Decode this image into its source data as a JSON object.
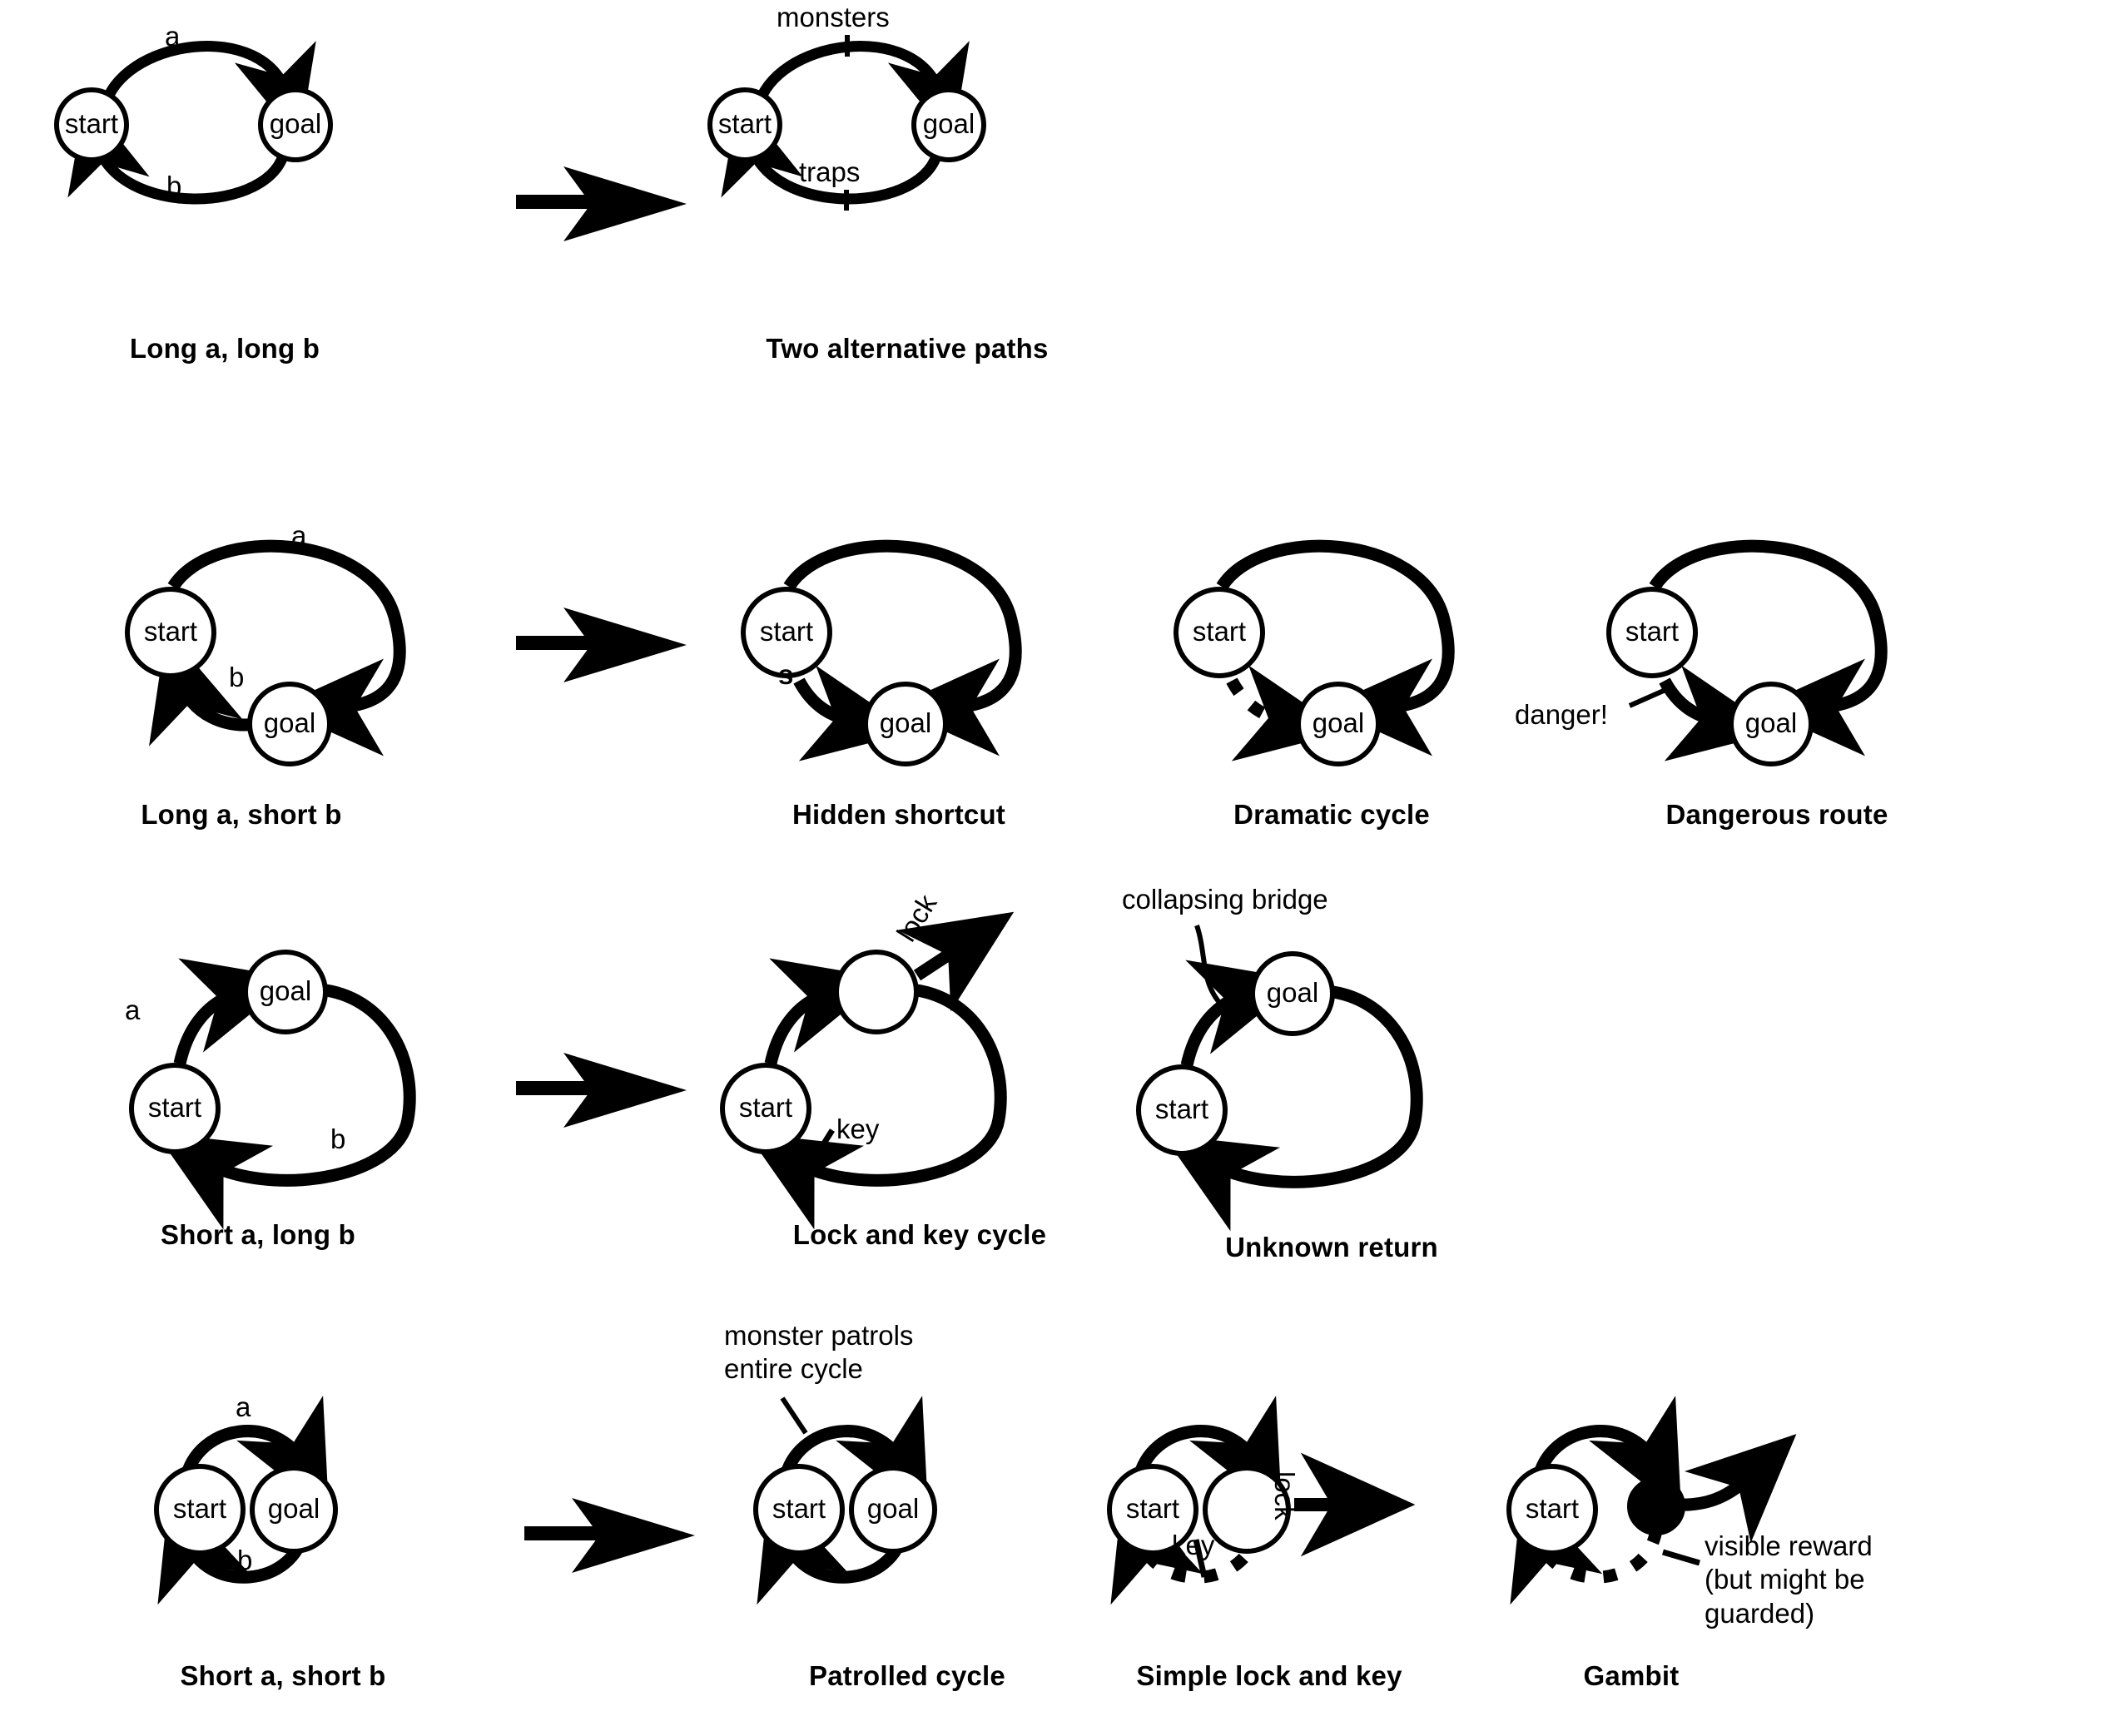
{
  "figure": {
    "title_text_present": false,
    "node_labels": {
      "start": "start",
      "goal": "goal",
      "blank": ""
    }
  },
  "rows": [
    {
      "row_id": "row-1",
      "base_caption": "Long a, long b",
      "base_edge_labels": [
        "a",
        "b"
      ],
      "variants": [
        {
          "caption": "Two alternative paths",
          "annotations": [
            "monsters",
            "traps"
          ]
        }
      ]
    },
    {
      "row_id": "row-2",
      "base_caption": "Long a, short b",
      "base_edge_labels": [
        "a",
        "b"
      ],
      "variants": [
        {
          "caption": "Hidden shortcut",
          "annotations": [
            "s"
          ]
        },
        {
          "caption": "Dramatic cycle",
          "annotations": []
        },
        {
          "caption": "Dangerous route",
          "annotations": [
            "danger!"
          ]
        }
      ]
    },
    {
      "row_id": "row-3",
      "base_caption": "Short a, long b",
      "base_edge_labels": [
        "a",
        "b"
      ],
      "variants": [
        {
          "caption": "Lock and key cycle",
          "annotations": [
            "lock",
            "key"
          ]
        },
        {
          "caption": "Unknown return",
          "annotations": [
            "collapsing bridge"
          ]
        }
      ]
    },
    {
      "row_id": "row-4",
      "base_caption": "Short a, short b",
      "base_edge_labels": [
        "a",
        "b"
      ],
      "variants": [
        {
          "caption": "Patrolled cycle",
          "annotations": [
            "monster patrols\nentire cycle"
          ]
        },
        {
          "caption": "Simple lock and key",
          "annotations": [
            "key",
            "lock"
          ]
        },
        {
          "caption": "Gambit",
          "annotations": [
            "visible reward\n(but might be guarded)"
          ]
        }
      ]
    }
  ],
  "captions": {
    "long_a_long_b": "Long a, long b",
    "two_alternative_paths": "Two alternative paths",
    "long_a_short_b": "Long a, short b",
    "hidden_shortcut": "Hidden shortcut",
    "dramatic_cycle": "Dramatic cycle",
    "dangerous_route": "Dangerous route",
    "short_a_long_b": "Short a, long b",
    "lock_and_key_cycle": "Lock and key cycle",
    "unknown_return": "Unknown return",
    "short_a_short_b": "Short a, short b",
    "patrolled_cycle": "Patrolled cycle",
    "simple_lock_and_key": "Simple lock and key",
    "gambit": "Gambit"
  },
  "labels": {
    "a": "a",
    "b": "b",
    "s": "s",
    "monsters": "monsters",
    "traps": "traps",
    "danger": "danger!",
    "lock": "lock",
    "key": "key",
    "collapsing_bridge": "collapsing bridge",
    "monster_patrols": "monster patrols\nentire cycle",
    "visible_reward": "visible reward\n(but might be guarded)",
    "start": "start",
    "goal": "goal"
  },
  "colors": {
    "ink": "#000000",
    "background": "#ffffff",
    "node_fill": "#ffffff"
  }
}
